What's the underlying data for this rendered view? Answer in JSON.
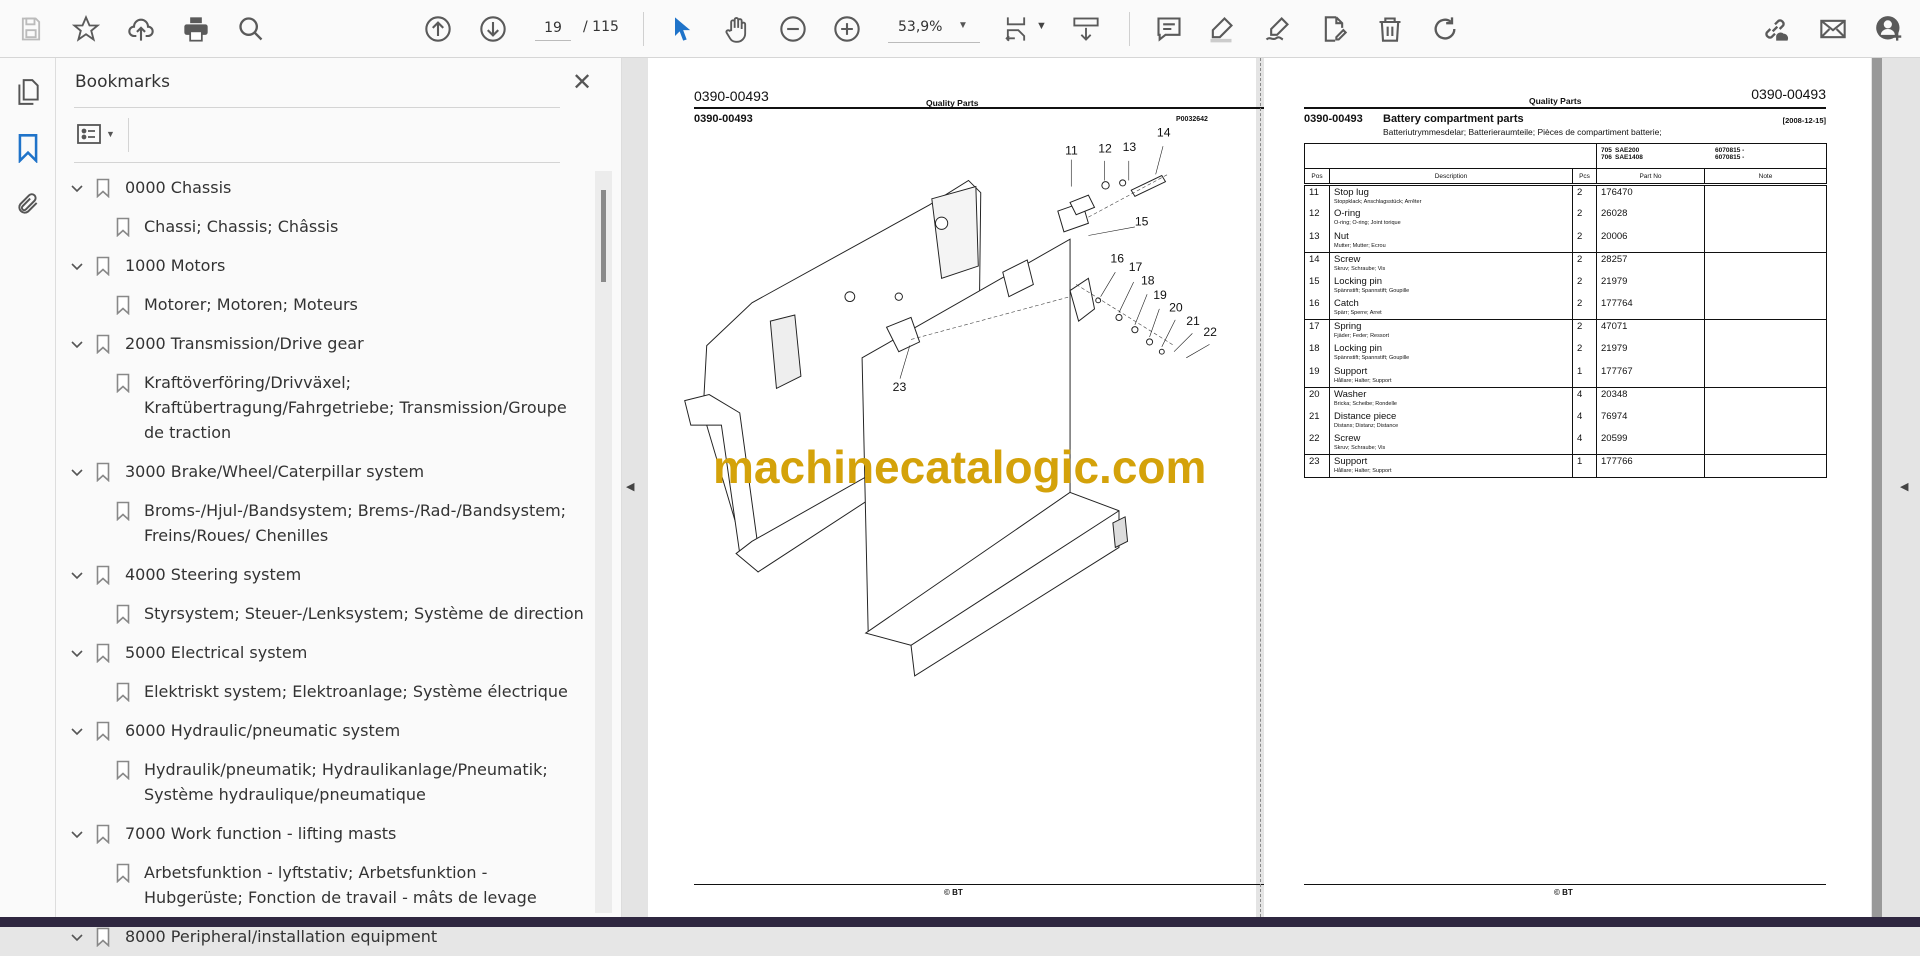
{
  "toolbar": {
    "page_current": "19",
    "page_total": "/ 115",
    "zoom": "53,9%"
  },
  "panel": {
    "title": "Bookmarks",
    "close": "✕"
  },
  "bookmarks": [
    {
      "label": "0000 Chassis",
      "child": "Chassi; Chassis; Châssis"
    },
    {
      "label": "1000 Motors",
      "child": "Motorer; Motoren; Moteurs"
    },
    {
      "label": "2000 Transmission/Drive gear",
      "child": "Kraftöverföring/Drivväxel; Kraftübertragung/Fahrgetriebe; Transmission/Groupe de traction"
    },
    {
      "label": "3000 Brake/Wheel/Caterpillar system",
      "child": "Broms-/Hjul-/Bandsystem; Brems-/Rad-/Bandsystem; Freins/Roues/ Chenilles"
    },
    {
      "label": "4000 Steering system",
      "child": "Styrsystem; Steuer-/Lenksystem; Système de direction"
    },
    {
      "label": "5000 Electrical system",
      "child": "Elektriskt system; Elektroanlage; Système électrique"
    },
    {
      "label": "6000 Hydraulic/pneumatic system",
      "child": "Hydraulik/pneumatik; Hydraulikanlage/Pneumatik; Système hydraulique/pneumatique"
    },
    {
      "label": "7000 Work function - lifting masts",
      "child": "Arbetsfunktion - lyftstativ; Arbetsfunktion - Hubgerüste; Fonction de travail - mâts de levage"
    },
    {
      "label": "8000 Peripheral/installation equipment"
    }
  ],
  "left_page": {
    "doc_no": "0390-00493",
    "header": "Quality Parts",
    "section_no": "0390-00493",
    "drawing_id": "P0032642",
    "callouts": [
      "11",
      "12",
      "13",
      "14",
      "15",
      "16",
      "17",
      "18",
      "19",
      "20",
      "21",
      "22",
      "23"
    ],
    "footer": "© BT"
  },
  "watermark": "machinecatalogic.com",
  "right_page": {
    "header": "Quality Parts",
    "doc_no": "0390-00493",
    "section_no": "0390-00493",
    "title": "Battery compartment parts",
    "date": "[2008-12-15]",
    "subtitle": "Batteriutrymmesdelar; Batterieraumteile; Pièces de compartiment batterie;",
    "models": [
      {
        "code": "705",
        "name": "SAE200",
        "serial": "6070815 -"
      },
      {
        "code": "706",
        "name": "SAE1408",
        "serial": "6070815 -"
      }
    ],
    "columns": [
      "Pos",
      "Description",
      "Pcs",
      "Part No",
      "Note"
    ],
    "rows": [
      {
        "pos": "11",
        "desc": "Stop lug",
        "sub": "Stoppklack; Anschlagsstück; Arrêter",
        "pcs": "2",
        "part": "176470"
      },
      {
        "pos": "12",
        "desc": "O-ring",
        "sub": "O-ring; O-ring; Joint torique",
        "pcs": "2",
        "part": "26028"
      },
      {
        "pos": "13",
        "desc": "Nut",
        "sub": "Mutter; Mutter; Ecrou",
        "pcs": "2",
        "part": "20006"
      },
      {
        "pos": "14",
        "desc": "Screw",
        "sub": "Skruv; Schraube; Vis",
        "pcs": "2",
        "part": "28257"
      },
      {
        "pos": "15",
        "desc": "Locking pin",
        "sub": "Spännstift; Spannstift; Goupille",
        "pcs": "2",
        "part": "21979"
      },
      {
        "pos": "16",
        "desc": "Catch",
        "sub": "Spärr; Sperre; Arret",
        "pcs": "2",
        "part": "177764"
      },
      {
        "pos": "17",
        "desc": "Spring",
        "sub": "Fjäder; Feder; Ressort",
        "pcs": "2",
        "part": "47071"
      },
      {
        "pos": "18",
        "desc": "Locking pin",
        "sub": "Spännstift; Spannstift; Goupille",
        "pcs": "2",
        "part": "21979"
      },
      {
        "pos": "19",
        "desc": "Support",
        "sub": "Hållare; Halter; Support",
        "pcs": "1",
        "part": "177767"
      },
      {
        "pos": "20",
        "desc": "Washer",
        "sub": "Bricka; Scheibe; Rondelle",
        "pcs": "4",
        "part": "20348"
      },
      {
        "pos": "21",
        "desc": "Distance piece",
        "sub": "Distans; Distanz; Distance",
        "pcs": "4",
        "part": "76974"
      },
      {
        "pos": "22",
        "desc": "Screw",
        "sub": "Skruv; Schraube; Vis",
        "pcs": "4",
        "part": "20599"
      },
      {
        "pos": "23",
        "desc": "Support",
        "sub": "Hållare; Halter; Support",
        "pcs": "1",
        "part": "177766"
      }
    ],
    "footer": "© BT"
  }
}
